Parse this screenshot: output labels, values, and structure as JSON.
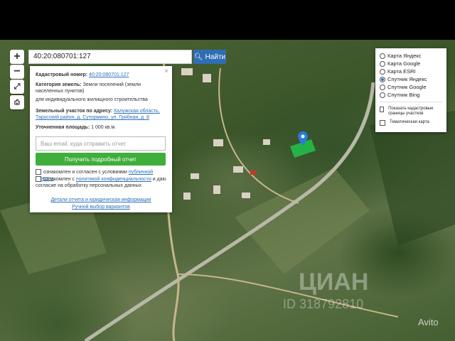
{
  "search": {
    "value": "40:20:080701:127",
    "button_label": "Найти"
  },
  "zoom": {
    "in_label": "+",
    "out_label": "−"
  },
  "info_panel": {
    "cadastral_label": "Кадастровый номер:",
    "cadastral_value": "40:20:080701:127",
    "category_label": "Категория земель:",
    "category_value": "Земли поселений (земли населенных пунктов)",
    "usage_value": "для индивидуального жилищного строительства",
    "address_label": "Земельный участок по адресу:",
    "address_value": "Калужская область, Тарусский район, д. Сутормино, ул. Грибная, д. 8",
    "area_label": "Уточненная площадь:",
    "area_value": "1 000 кв.м.",
    "email_placeholder": "Ваш email, куда отправить отчет",
    "report_button": "Получить подробный отчет",
    "agree_offer_text": "ознакомлен и согласен с условиями",
    "agree_offer_link": "публичной оферты",
    "agree_privacy_text": "ознакомлен с",
    "agree_privacy_link": "политикой конфиденциальности",
    "agree_privacy_tail": "и даю согласие на обработку персональных данных",
    "details_link": "Детали отчета и юридическая информация",
    "manual_link": "Ручной выбор вариантов"
  },
  "layers": {
    "options": [
      {
        "label": "Карта Яндекс",
        "selected": false
      },
      {
        "label": "Карта Google",
        "selected": false
      },
      {
        "label": "Карта ESRI",
        "selected": false
      },
      {
        "label": "Спутник Яндекс",
        "selected": true
      },
      {
        "label": "Спутник Google",
        "selected": false
      },
      {
        "label": "Спутник Bing",
        "selected": false
      }
    ],
    "show_boundaries": "Показать кадастровые границы участков",
    "thematic_map": "Тематическая карта"
  },
  "watermark": {
    "brand": "ЦИАН",
    "id_text": "ID 318792810",
    "avito": "Avito"
  },
  "colors": {
    "accent": "#2f6db5",
    "report_button": "#3fae3a",
    "parcel": "#22c34a",
    "marker": "#2a7bd8"
  }
}
